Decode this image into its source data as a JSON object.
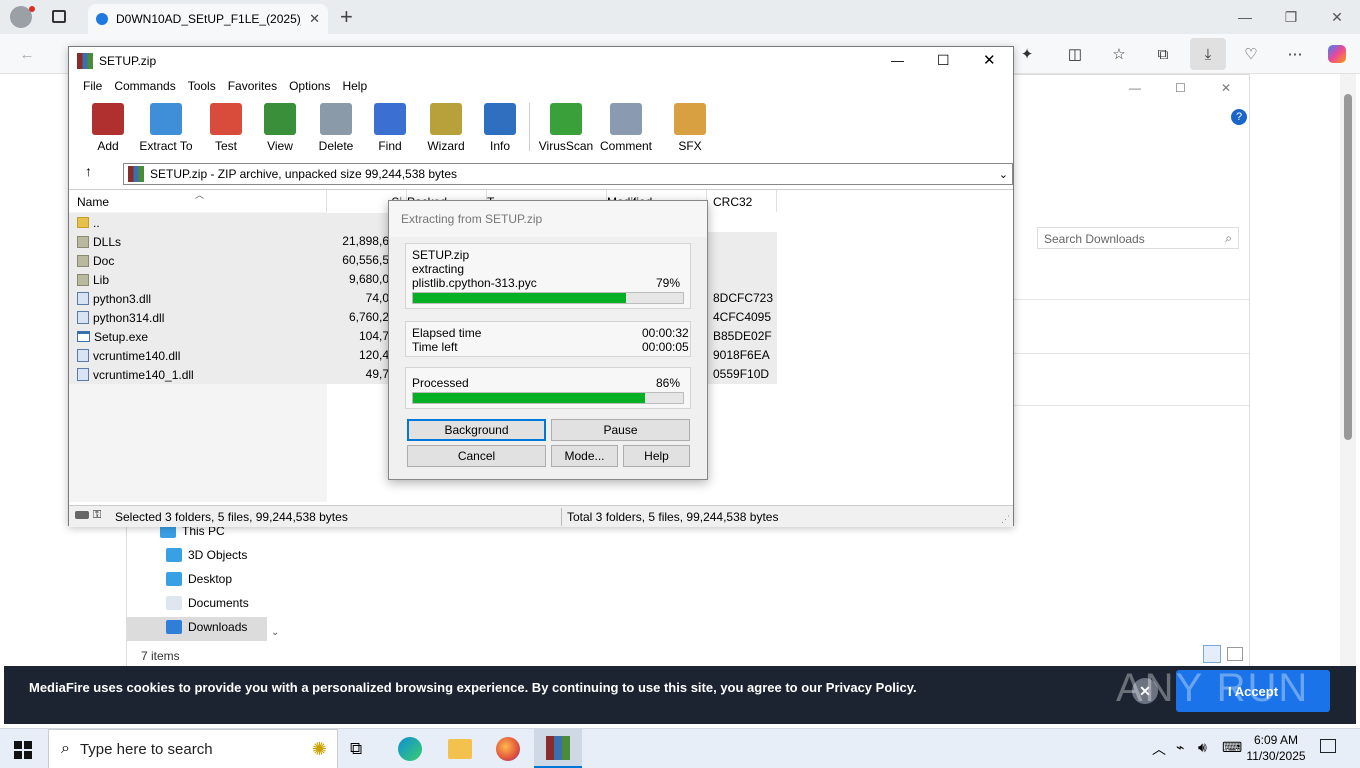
{
  "browser": {
    "tab_title": "D0WN10AD_SEtUP_F1LE_(2025)_",
    "new_tab_label": "+",
    "search_downloads_placeholder": "Search Downloads"
  },
  "explorer": {
    "nav_items": [
      {
        "label": "This PC",
        "icon": "pc-icon"
      },
      {
        "label": "3D Objects",
        "icon": "cube-icon"
      },
      {
        "label": "Desktop",
        "icon": "desktop-icon"
      },
      {
        "label": "Documents",
        "icon": "document-icon"
      },
      {
        "label": "Downloads",
        "icon": "download-arrow-icon"
      }
    ],
    "items_count": "7 items"
  },
  "cookie": {
    "text": "MediaFire uses cookies to provide you with a personalized browsing experience. By continuing to use this site, you agree to our Privacy Policy.",
    "accept_label": "I Accept"
  },
  "watermark": "ANY RUN",
  "winrar": {
    "title": "SETUP.zip",
    "menu": [
      "File",
      "Commands",
      "Tools",
      "Favorites",
      "Options",
      "Help"
    ],
    "tools": [
      {
        "label": "Add",
        "color": "#b03030"
      },
      {
        "label": "Extract To",
        "color": "#3f8ed8"
      },
      {
        "label": "Test",
        "color": "#d94b3a"
      },
      {
        "label": "View",
        "color": "#3a8f3a"
      },
      {
        "label": "Delete",
        "color": "#8a9aa8"
      },
      {
        "label": "Find",
        "color": "#3b6fd1"
      },
      {
        "label": "Wizard",
        "color": "#b8a03a"
      },
      {
        "label": "Info",
        "color": "#2e6fc0"
      },
      {
        "label": "VirusScan",
        "color": "#3aa13a"
      },
      {
        "label": "Comment",
        "color": "#8a9ab0"
      },
      {
        "label": "SFX",
        "color": "#d8a040"
      }
    ],
    "path": "SETUP.zip - ZIP archive, unpacked size 99,244,538 bytes",
    "columns": {
      "name": "Name",
      "size": "Si",
      "packed": "Packed",
      "type": "T",
      "modified": "Modified",
      "crc": "CRC32"
    },
    "files": [
      {
        "name": "..",
        "size": "",
        "crc": "",
        "kind": "up"
      },
      {
        "name": "DLLs",
        "size": "21,898,6",
        "crc": "",
        "kind": "folder"
      },
      {
        "name": "Doc",
        "size": "60,556,5",
        "crc": "",
        "kind": "folder"
      },
      {
        "name": "Lib",
        "size": "9,680,0",
        "crc": "",
        "kind": "folder"
      },
      {
        "name": "python3.dll",
        "size": "74,0",
        "crc": "8DCFC723",
        "kind": "dll"
      },
      {
        "name": "python314.dll",
        "size": "6,760,2",
        "crc": "4CFC4095",
        "kind": "dll"
      },
      {
        "name": "Setup.exe",
        "size": "104,7",
        "crc": "B85DE02F",
        "kind": "exe"
      },
      {
        "name": "vcruntime140.dll",
        "size": "120,4",
        "crc": "9018F6EA",
        "kind": "dll"
      },
      {
        "name": "vcruntime140_1.dll",
        "size": "49,7",
        "crc": "0559F10D",
        "kind": "dll"
      }
    ],
    "status_left": "Selected 3 folders, 5 files, 99,244,538 bytes",
    "status_right": "Total 3 folders, 5 files, 99,244,538 bytes"
  },
  "dialog": {
    "title": "Extracting from SETUP.zip",
    "archive": "SETUP.zip",
    "action": "extracting",
    "current_file": "plistlib.cpython-313.pyc",
    "file_percent_text": "79%",
    "file_progress": 0.79,
    "elapsed_label": "Elapsed time",
    "elapsed_value": "00:00:32",
    "left_label": "Time left",
    "left_value": "00:00:05",
    "processed_label": "Processed",
    "processed_percent_text": "86%",
    "processed_progress": 0.86,
    "buttons": {
      "background": "Background",
      "pause": "Pause",
      "cancel": "Cancel",
      "mode": "Mode...",
      "help": "Help"
    }
  },
  "taskbar": {
    "search_placeholder": "Type here to search",
    "time": "6:09 AM",
    "date": "11/30/2025"
  }
}
